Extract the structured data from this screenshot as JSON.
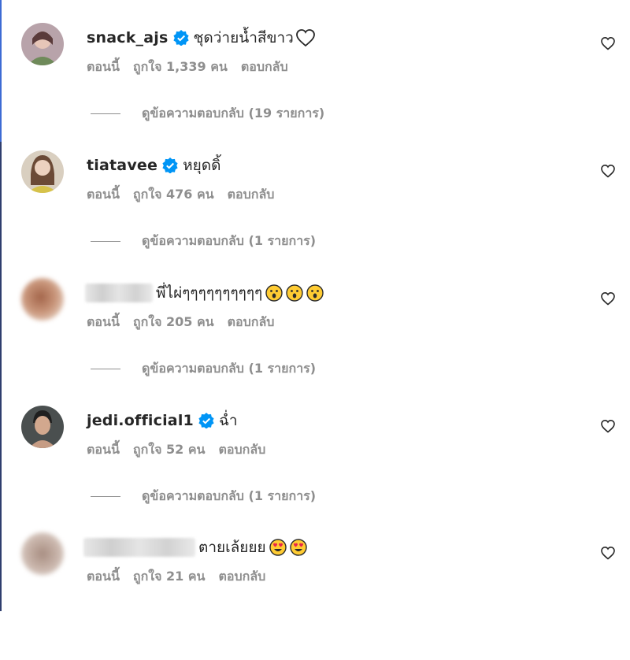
{
  "comments": [
    {
      "username": "snack_ajs",
      "verified": true,
      "text": "ชุดว่ายน้ำสีขาว",
      "trail": "heart-outline",
      "time": "ตอนนี้",
      "likes": "ถูกใจ 1,339 คน",
      "reply": "ตอบกลับ",
      "view_replies": "ดูข้อความตอบกลับ (19 รายการ)",
      "avatar": "avatar-woman-green",
      "avatar_colors": [
        "#9d7f86",
        "#6f8a5a"
      ]
    },
    {
      "username": "tiatavee",
      "verified": true,
      "text": "หยุดดิ้",
      "time": "ตอนนี้",
      "likes": "ถูกใจ 476 คน",
      "reply": "ตอบกลับ",
      "view_replies": "ดูข้อความตอบกลับ (1 รายการ)",
      "avatar": "avatar-woman-yellow",
      "avatar_colors": [
        "#c9b79a",
        "#d6c24a"
      ]
    },
    {
      "username": "",
      "blurred_name": true,
      "text": "พี่ไผ่ๆๆๆๆๆๆๆๆๆๆ",
      "emojis": [
        "hushed-face",
        "hushed-face",
        "hushed-face"
      ],
      "time": "ตอนนี้",
      "likes": "ถูกใจ 205 คน",
      "reply": "ตอบกลับ",
      "view_replies": "ดูข้อความตอบกลับ (1 รายการ)",
      "avatar": "avatar-blurred",
      "avatar_colors": [
        "#b07a5c",
        "#d8b49a"
      ]
    },
    {
      "username": "jedi.official1",
      "verified": true,
      "text": "ฉ่ำ",
      "time": "ตอนนี้",
      "likes": "ถูกใจ 52 คน",
      "reply": "ตอบกลับ",
      "view_replies": "ดูข้อความตอบกลับ (1 รายการ)",
      "avatar": "avatar-man",
      "avatar_colors": [
        "#3b3f3e",
        "#c69c84"
      ]
    },
    {
      "username": "",
      "blurred_name": true,
      "text": "ตายเล้ยยย",
      "emojis": [
        "heart-eyes-face",
        "heart-eyes-face"
      ],
      "time": "ตอนนี้",
      "likes": "ถูกใจ 21 คน",
      "reply": "ตอบกลับ",
      "avatar": "avatar-blurred",
      "avatar_colors": [
        "#b9a59b",
        "#d9cbc2"
      ]
    }
  ],
  "colors": {
    "text": "#262626",
    "muted": "#8e8e8e",
    "verified": "#0095f6"
  }
}
